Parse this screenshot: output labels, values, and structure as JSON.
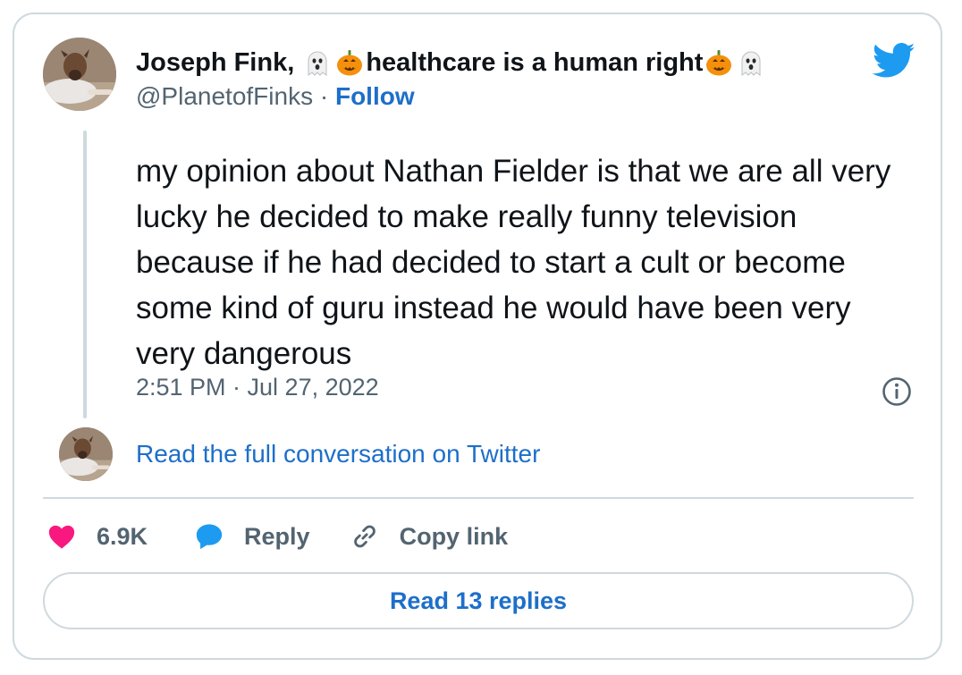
{
  "author": {
    "name_prefix": "Joseph Fink,",
    "name_middle": "healthcare is a human right",
    "handle": "@PlanetofFinks",
    "separator": "·",
    "follow_label": "Follow",
    "name_emojis": [
      "ghost-emoji",
      "jack-o-lantern-emoji",
      "jack-o-lantern-emoji",
      "ghost-emoji"
    ]
  },
  "tweet": {
    "text": "my opinion about Nathan Fielder is that we are all very lucky he decided to make really funny television because if he had decided to start a cult or become some kind of guru instead he would have been very very dangerous",
    "timestamp": "2:51 PM · Jul 27, 2022"
  },
  "conversation_link": "Read the full conversation on Twitter",
  "actions": {
    "like_count": "6.9K",
    "reply_label": "Reply",
    "copy_link_label": "Copy link"
  },
  "read_replies_label": "Read 13 replies",
  "colors": {
    "brand": "#1d9bf0",
    "link": "#1d6fc9",
    "like": "#f91880",
    "secondary_text": "#536471",
    "border": "#cfd9de"
  },
  "icons": {
    "brand": "twitter-bird-icon",
    "info": "info-icon",
    "like": "heart-icon",
    "reply": "speech-bubble-icon",
    "copy": "link-icon"
  }
}
